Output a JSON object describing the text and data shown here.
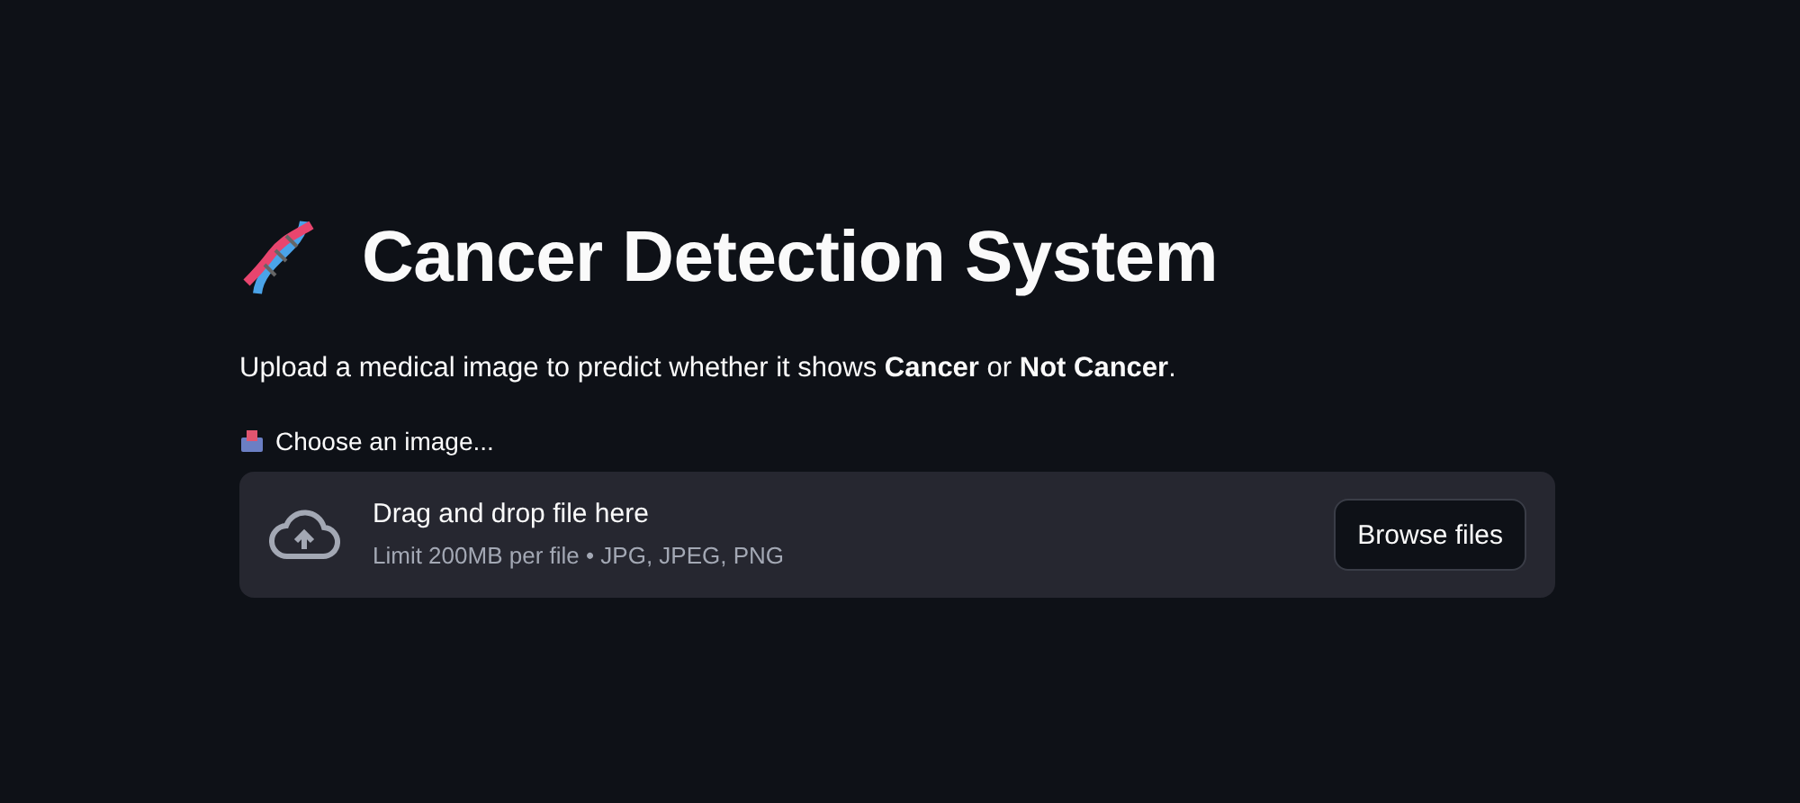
{
  "title": "Cancer Detection System",
  "description": "Upload a medical image to predict whether it shows **Cancer** or **Not Cancer**.",
  "uploader": {
    "label": "Choose an image...",
    "drop_text": "Drag and drop file here",
    "limit_text": "Limit 200MB per file • JPG, JPEG, PNG",
    "button": "Browse files"
  }
}
